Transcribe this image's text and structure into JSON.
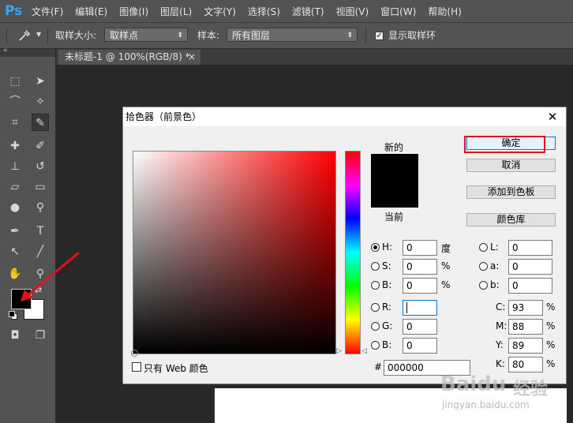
{
  "app": {
    "logo": "Ps"
  },
  "menu": {
    "items": [
      "文件(F)",
      "编辑(E)",
      "图像(I)",
      "图层(L)",
      "文字(Y)",
      "选择(S)",
      "滤镜(T)",
      "视图(V)",
      "窗口(W)",
      "帮助(H)"
    ]
  },
  "options": {
    "sample_size_label": "取样大小:",
    "sample_size_value": "取样点",
    "sample_label": "样本:",
    "sample_value": "所有图层",
    "show_ring_label": "显示取样环",
    "show_ring_checked": true
  },
  "document": {
    "tab_title": "未标题-1 @ 100%(RGB/8) *",
    "close_glyph": "×"
  },
  "dialog": {
    "title": "拾色器（前景色）",
    "close_glyph": "✕",
    "new_label": "新的",
    "current_label": "当前",
    "buttons": {
      "ok": "确定",
      "cancel": "取消",
      "add_swatch": "添加到色板",
      "libraries": "颜色库"
    },
    "fields": {
      "H": {
        "label": "H:",
        "value": "0",
        "unit": "度"
      },
      "S": {
        "label": "S:",
        "value": "0",
        "unit": "%"
      },
      "Bv": {
        "label": "B:",
        "value": "0",
        "unit": "%"
      },
      "R": {
        "label": "R:",
        "value": ""
      },
      "G": {
        "label": "G:",
        "value": "0"
      },
      "Bc": {
        "label": "B:",
        "value": "0"
      },
      "L": {
        "label": "L:",
        "value": "0"
      },
      "a": {
        "label": "a:",
        "value": "0"
      },
      "b": {
        "label": "b:",
        "value": "0"
      },
      "C": {
        "label": "C:",
        "value": "93",
        "unit": "%"
      },
      "M": {
        "label": "M:",
        "value": "88",
        "unit": "%"
      },
      "Y": {
        "label": "Y:",
        "value": "89",
        "unit": "%"
      },
      "K": {
        "label": "K:",
        "value": "80",
        "unit": "%"
      }
    },
    "hex_label": "#",
    "hex_value": "000000",
    "web_only_label": "只有 Web 颜色",
    "new_color": "#000000",
    "current_color": "#000000"
  },
  "colors": {
    "highlight": "#e0141e",
    "foreground": "#000000",
    "background": "#ffffff"
  },
  "watermark": {
    "brand": "Baidu",
    "brand_cn": "经验",
    "url": "jingyan.baidu.com"
  }
}
